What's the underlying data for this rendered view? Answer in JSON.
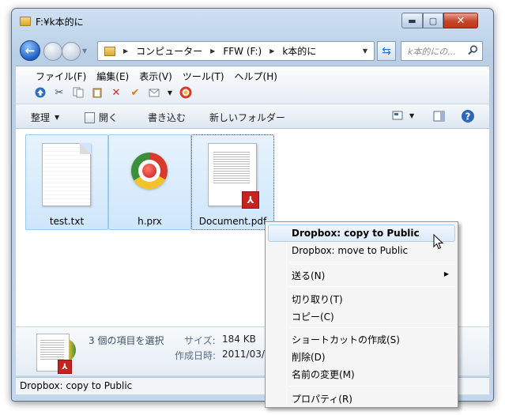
{
  "window": {
    "title": "F:¥k本的に",
    "controls": {
      "minimize": "▬",
      "maximize": "▢",
      "close": "✕"
    }
  },
  "address": {
    "segments": [
      "コンピューター",
      "FFW (F:)",
      "k本的に"
    ],
    "search_placeholder": "k本的にの..."
  },
  "menu": [
    "ファイル(F)",
    "編集(E)",
    "表示(V)",
    "ツール(T)",
    "ヘルプ(H)"
  ],
  "toolbar_icons": [
    "up-icon",
    "cut-icon",
    "copy-icon",
    "paste-icon",
    "delete-icon",
    "check-icon",
    "mail-icon",
    "dropdown-icon",
    "properties-icon"
  ],
  "commands": {
    "organize": "整理",
    "open": "開く",
    "burn": "書き込む",
    "new_folder": "新しいフォルダー"
  },
  "files": [
    {
      "name": "test.txt",
      "icon": "text-file-icon"
    },
    {
      "name": "h.prx",
      "icon": "prx-file-icon"
    },
    {
      "name": "Document.pdf",
      "icon": "pdf-file-icon"
    }
  ],
  "details": {
    "selection": "3 個の項目を選択",
    "size_label": "サイズ:",
    "size_value": "184 KB",
    "date_label": "作成日時:",
    "date_value": "2011/03/0"
  },
  "status": "Dropbox: copy to Public",
  "context_menu": {
    "items": [
      {
        "label": "Dropbox: copy to Public",
        "bold": true,
        "highlighted": true
      },
      {
        "label": "Dropbox: move to Public"
      },
      {
        "label": "送る(N)",
        "submenu": true
      },
      {
        "label": "切り取り(T)"
      },
      {
        "label": "コピー(C)"
      },
      {
        "label": "ショートカットの作成(S)"
      },
      {
        "label": "削除(D)"
      },
      {
        "label": "名前の変更(M)"
      },
      {
        "label": "プロパティ(R)"
      }
    ]
  },
  "colors": {
    "accent": "#2162c8",
    "selection_fill": "#cfe6fb",
    "close_button": "#c7442a"
  }
}
